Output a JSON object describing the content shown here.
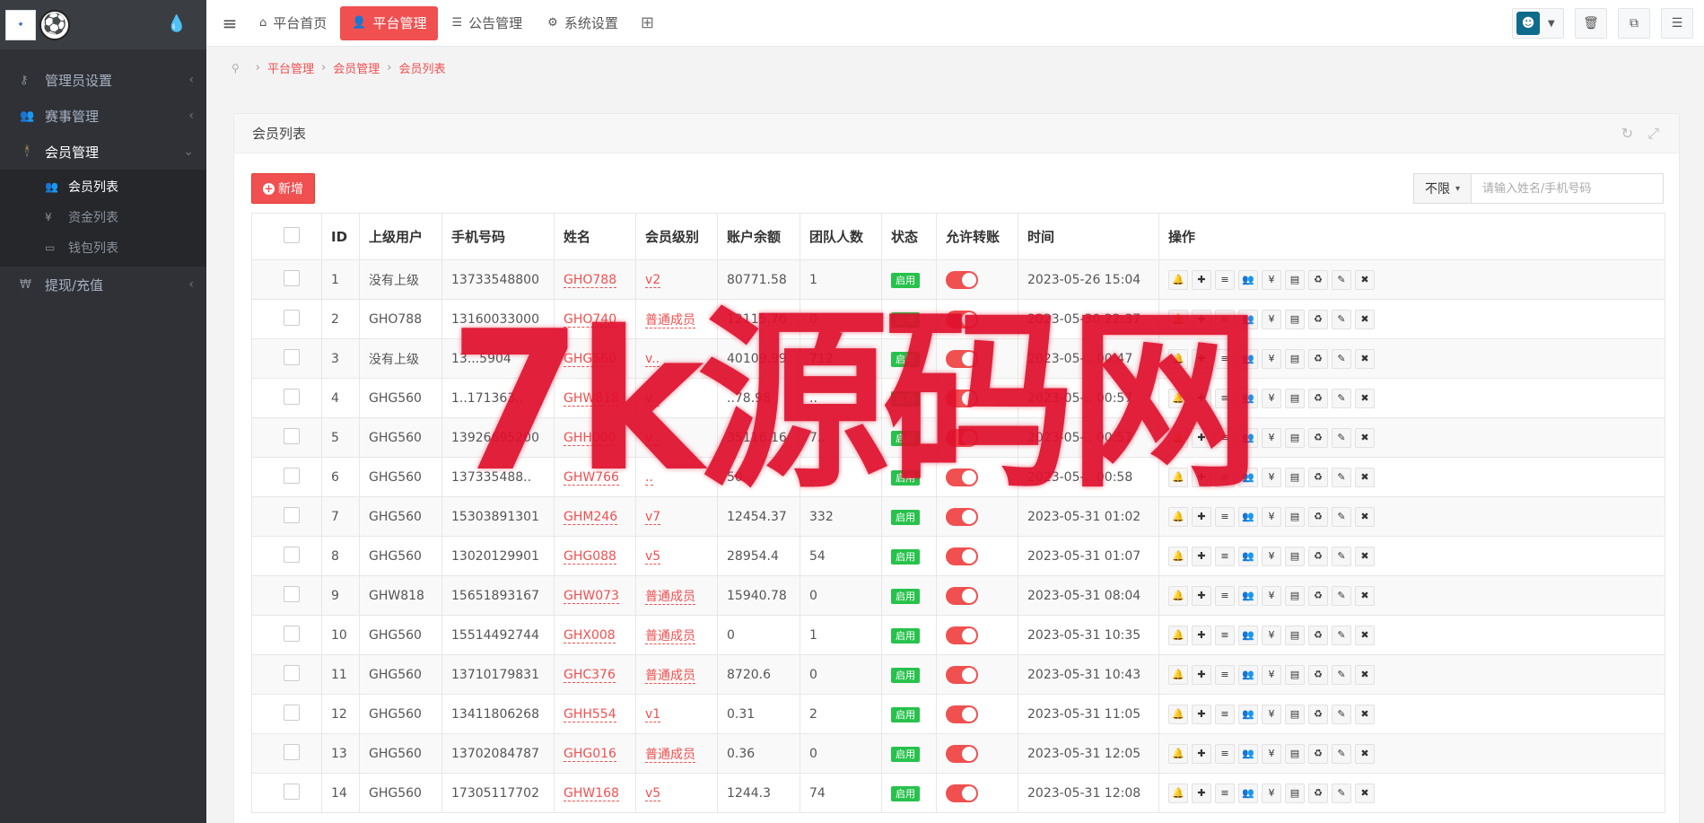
{
  "sidebar": {
    "logo_text": "LOGO",
    "items": [
      {
        "label": "管理员设置",
        "icon": "key-icon"
      },
      {
        "label": "赛事管理",
        "icon": "users-icon"
      },
      {
        "label": "会员管理",
        "icon": "person-icon",
        "active": true
      },
      {
        "label": "提现/充值",
        "icon": "won-icon"
      }
    ],
    "sub_items": [
      {
        "label": "会员列表",
        "icon": "users-icon",
        "active": true
      },
      {
        "label": "资金列表",
        "icon": "yen-icon"
      },
      {
        "label": "钱包列表",
        "icon": "wallet-icon"
      }
    ]
  },
  "topnav": {
    "tabs": [
      {
        "label": "平台首页",
        "icon": "home-icon"
      },
      {
        "label": "平台管理",
        "icon": "user-icon",
        "active": true
      },
      {
        "label": "公告管理",
        "icon": "list-icon"
      },
      {
        "label": "系统设置",
        "icon": "gear-icon"
      }
    ]
  },
  "breadcrumb": [
    "平台管理",
    "会员管理",
    "会员列表"
  ],
  "panel": {
    "title": "会员列表",
    "add_label": "新增",
    "filter_label": "不限",
    "search_placeholder": "请输入姓名/手机号码"
  },
  "table": {
    "headers": [
      "",
      "ID",
      "上级用户",
      "手机号码",
      "姓名",
      "会员级别",
      "账户余额",
      "团队人数",
      "状态",
      "允许转账",
      "时间",
      "操作"
    ],
    "status_label": "启用",
    "rows": [
      {
        "id": "1",
        "parent": "没有上级",
        "phone": "13733548800",
        "name": "GHO788",
        "level": "v2",
        "balance": "80771.58",
        "team": "1",
        "time": "2023-05-26 15:04"
      },
      {
        "id": "2",
        "parent": "GHO788",
        "phone": "13160033000",
        "name": "GHO740",
        "level": "普通成员",
        "balance": "12115.76",
        "team": "0",
        "time": "2023-05-30 22:37"
      },
      {
        "id": "3",
        "parent": "没有上级",
        "phone": "13...5904",
        "name": "GHG560",
        "level": "v..",
        "balance": "40109.99",
        "team": "712",
        "time": "2023-05-.. 00:47"
      },
      {
        "id": "4",
        "parent": "GHG560",
        "phone": "1..171363..",
        "name": "GHW818",
        "level": "v..",
        "balance": "..78.98",
        "team": "..",
        "time": "2023-05-.. 00:57"
      },
      {
        "id": "5",
        "parent": "GHG560",
        "phone": "13926695200",
        "name": "GHH000",
        "level": "v..",
        "balance": "35116.16",
        "team": "7..",
        "time": "2023-05-.. 00:57"
      },
      {
        "id": "6",
        "parent": "GHG560",
        "phone": "137335488..",
        "name": "GHW766",
        "level": "..",
        "balance": "50..",
        "team": "..",
        "time": "2023-05-.. 00:58"
      },
      {
        "id": "7",
        "parent": "GHG560",
        "phone": "15303891301",
        "name": "GHM246",
        "level": "v7",
        "balance": "12454.37",
        "team": "332",
        "time": "2023-05-31 01:02"
      },
      {
        "id": "8",
        "parent": "GHG560",
        "phone": "13020129901",
        "name": "GHG088",
        "level": "v5",
        "balance": "28954.4",
        "team": "54",
        "time": "2023-05-31 01:07"
      },
      {
        "id": "9",
        "parent": "GHW818",
        "phone": "15651893167",
        "name": "GHW073",
        "level": "普通成员",
        "balance": "15940.78",
        "team": "0",
        "time": "2023-05-31 08:04"
      },
      {
        "id": "10",
        "parent": "GHG560",
        "phone": "15514492744",
        "name": "GHX008",
        "level": "普通成员",
        "balance": "0",
        "team": "1",
        "time": "2023-05-31 10:35"
      },
      {
        "id": "11",
        "parent": "GHG560",
        "phone": "13710179831",
        "name": "GHC376",
        "level": "普通成员",
        "balance": "8720.6",
        "team": "0",
        "time": "2023-05-31 10:43"
      },
      {
        "id": "12",
        "parent": "GHG560",
        "phone": "13411806268",
        "name": "GHH554",
        "level": "v1",
        "balance": "0.31",
        "team": "2",
        "time": "2023-05-31 11:05"
      },
      {
        "id": "13",
        "parent": "GHG560",
        "phone": "13702084787",
        "name": "GHG016",
        "level": "普通成员",
        "balance": "0.36",
        "team": "0",
        "time": "2023-05-31 12:05"
      },
      {
        "id": "14",
        "parent": "GHG560",
        "phone": "17305117702",
        "name": "GHW168",
        "level": "v5",
        "balance": "1244.3",
        "team": "74",
        "time": "2023-05-31 12:08"
      }
    ],
    "op_icons": [
      "bell-icon",
      "plus-icon",
      "list-icon",
      "users-icon",
      "yen-icon",
      "card-icon",
      "recycle-icon",
      "pencil-icon",
      "close-icon"
    ]
  },
  "watermark": "7k源码网",
  "colors": {
    "accent": "#f05050",
    "sidebar_bg": "#2f3136",
    "badge": "#27c24c"
  }
}
